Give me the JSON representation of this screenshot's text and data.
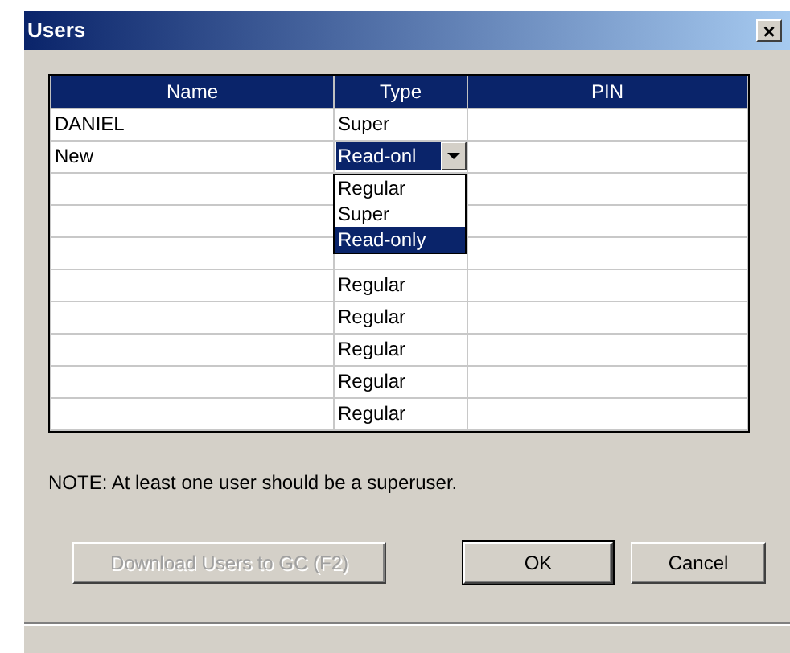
{
  "window": {
    "title": "Users",
    "close": "×"
  },
  "table": {
    "columns": [
      "Name",
      "Type",
      "PIN"
    ],
    "rows": [
      {
        "name": "DANIEL",
        "type": "Super",
        "pin": "",
        "editing": false
      },
      {
        "name": "New",
        "type": "Read-onl",
        "pin": "",
        "editing": true
      },
      {
        "name": "",
        "type": "",
        "pin": "",
        "editing": false
      },
      {
        "name": "",
        "type": "",
        "pin": "",
        "editing": false
      },
      {
        "name": "",
        "type": "",
        "pin": "",
        "editing": false
      },
      {
        "name": "",
        "type": "Regular",
        "pin": "",
        "editing": false
      },
      {
        "name": "",
        "type": "Regular",
        "pin": "",
        "editing": false
      },
      {
        "name": "",
        "type": "Regular",
        "pin": "",
        "editing": false
      },
      {
        "name": "",
        "type": "Regular",
        "pin": "",
        "editing": false
      },
      {
        "name": "",
        "type": "Regular",
        "pin": "",
        "editing": false
      }
    ]
  },
  "dropdown": {
    "options": [
      {
        "label": "Regular",
        "selected": false
      },
      {
        "label": "Super",
        "selected": false
      },
      {
        "label": "Read-only",
        "selected": true
      }
    ]
  },
  "note": "NOTE: At least one user should be a superuser.",
  "buttons": [
    {
      "label": "Download Users to GC (F2)",
      "disabled": true,
      "default": false
    },
    {
      "label": "OK",
      "disabled": false,
      "default": true
    },
    {
      "label": "Cancel",
      "disabled": false,
      "default": false
    }
  ]
}
